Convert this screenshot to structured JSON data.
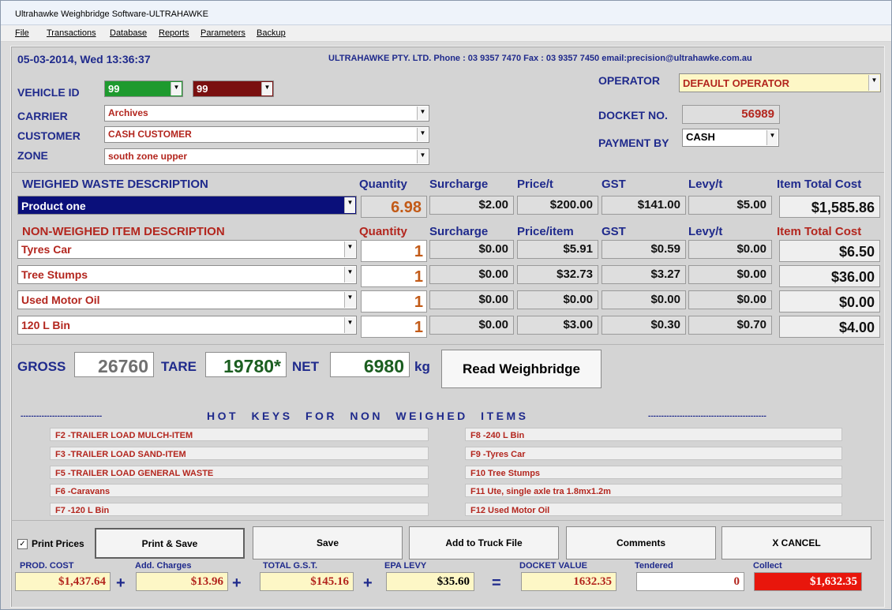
{
  "window": {
    "title": "Ultrahawke Weighbridge Software-ULTRAHAWKE"
  },
  "menu": [
    "File",
    "Transactions",
    "Database",
    "Reports",
    "Parameters",
    "Backup"
  ],
  "header": {
    "datetime": "05-03-2014, Wed 13:36:37",
    "company": "ULTRAHAWKE PTY. LTD. Phone : 03 9357 7470 Fax : 03 9357 7450 email:precision@ultrahawke.com.au"
  },
  "form": {
    "vehicle_id_label": "VEHICLE ID",
    "vehicle_id_1": "99",
    "vehicle_id_2": "99",
    "carrier_label": "CARRIER",
    "carrier": "Archives",
    "customer_label": "CUSTOMER",
    "customer": "CASH CUSTOMER",
    "zone_label": "ZONE",
    "zone": "south zone upper",
    "operator_label": "OPERATOR",
    "operator": "DEFAULT OPERATOR",
    "docket_label": "DOCKET NO.",
    "docket": "56989",
    "payment_label": "PAYMENT BY",
    "payment": "CASH"
  },
  "weighed": {
    "header": "WEIGHED WASTE DESCRIPTION",
    "col_quantity": "Quantity",
    "col_surcharge": "Surcharge",
    "col_price": "Price/t",
    "col_gst": "GST",
    "col_levy": "Levy/t",
    "col_total": "Item Total Cost",
    "product": "Product one",
    "quantity": "6.98",
    "surcharge": "$2.00",
    "price": "$200.00",
    "gst": "$141.00",
    "levy": "$5.00",
    "total": "$1,585.86"
  },
  "nonweighed": {
    "header": "NON-WEIGHED ITEM  DESCRIPTION",
    "col_quantity": "Quantity",
    "col_surcharge": "Surcharge",
    "col_price": "Price/item",
    "col_gst": "GST",
    "col_levy": "Levy/t",
    "col_total": "Item Total Cost",
    "rows": [
      {
        "item": "Tyres Car",
        "quantity": "1",
        "surcharge": "$0.00",
        "price": "$5.91",
        "gst": "$0.59",
        "levy": "$0.00",
        "total": "$6.50"
      },
      {
        "item": "Tree Stumps",
        "quantity": "1",
        "surcharge": "$0.00",
        "price": "$32.73",
        "gst": "$3.27",
        "levy": "$0.00",
        "total": "$36.00"
      },
      {
        "item": "Used Motor Oil",
        "quantity": "1",
        "surcharge": "$0.00",
        "price": "$0.00",
        "gst": "$0.00",
        "levy": "$0.00",
        "total": "$0.00"
      },
      {
        "item": "120 L Bin",
        "quantity": "1",
        "surcharge": "$0.00",
        "price": "$3.00",
        "gst": "$0.30",
        "levy": "$0.70",
        "total": "$4.00"
      }
    ]
  },
  "weights": {
    "gross_label": "GROSS",
    "gross": "26760",
    "tare_label": "TARE",
    "tare": "19780*",
    "net_label": "NET",
    "net": "6980",
    "unit": "kg",
    "read_button": "Read Weighbridge"
  },
  "hotkeys": {
    "banner_left": "-------------------------------",
    "banner_text": "HOT  KEYS  FOR   NON   WEIGHED  ITEMS",
    "banner_right": "---------------------------------------------",
    "left": [
      "F2 -TRAILER LOAD MULCH-ITEM",
      "F3 -TRAILER LOAD SAND-ITEM",
      "F5 -TRAILER LOAD GENERAL WASTE",
      "F6 -Caravans",
      "F7 -120 L Bin"
    ],
    "right": [
      "F8 -240 L Bin",
      "F9 -Tyres Car",
      "F10 Tree Stumps",
      "F11 Ute, single axle tra 1.8mx1.2m",
      "F12 Used Motor Oil"
    ]
  },
  "buttons": {
    "print_prices": "Print Prices",
    "print_save": "Print & Save",
    "save": "Save",
    "add_truck": "Add to Truck File",
    "comments": "Comments",
    "cancel": "X   CANCEL"
  },
  "summary": {
    "prod_cost_label": "PROD. COST",
    "prod_cost": "$1,437.64",
    "add_charges_label": "Add. Charges",
    "add_charges": "$13.96",
    "total_gst_label": "TOTAL G.S.T.",
    "total_gst": "$145.16",
    "epa_levy_label": "EPA LEVY",
    "epa_levy": "$35.60",
    "docket_value_label": "DOCKET VALUE",
    "docket_value": "1632.35",
    "tendered_label": "Tendered",
    "tendered": "0",
    "collect_label": "Collect",
    "collect": "$1,632.35",
    "op_plus": "+",
    "op_equals": "="
  },
  "colors": {
    "label_blue": "#1f2a8c",
    "label_red": "#b3261e",
    "vehicle_green": "#1e9a2e",
    "vehicle_maroon": "#7a1010",
    "selected_navy": "#0a0f7a",
    "collect_red": "#e8160c",
    "summary_yellow": "#fdf7c6"
  }
}
